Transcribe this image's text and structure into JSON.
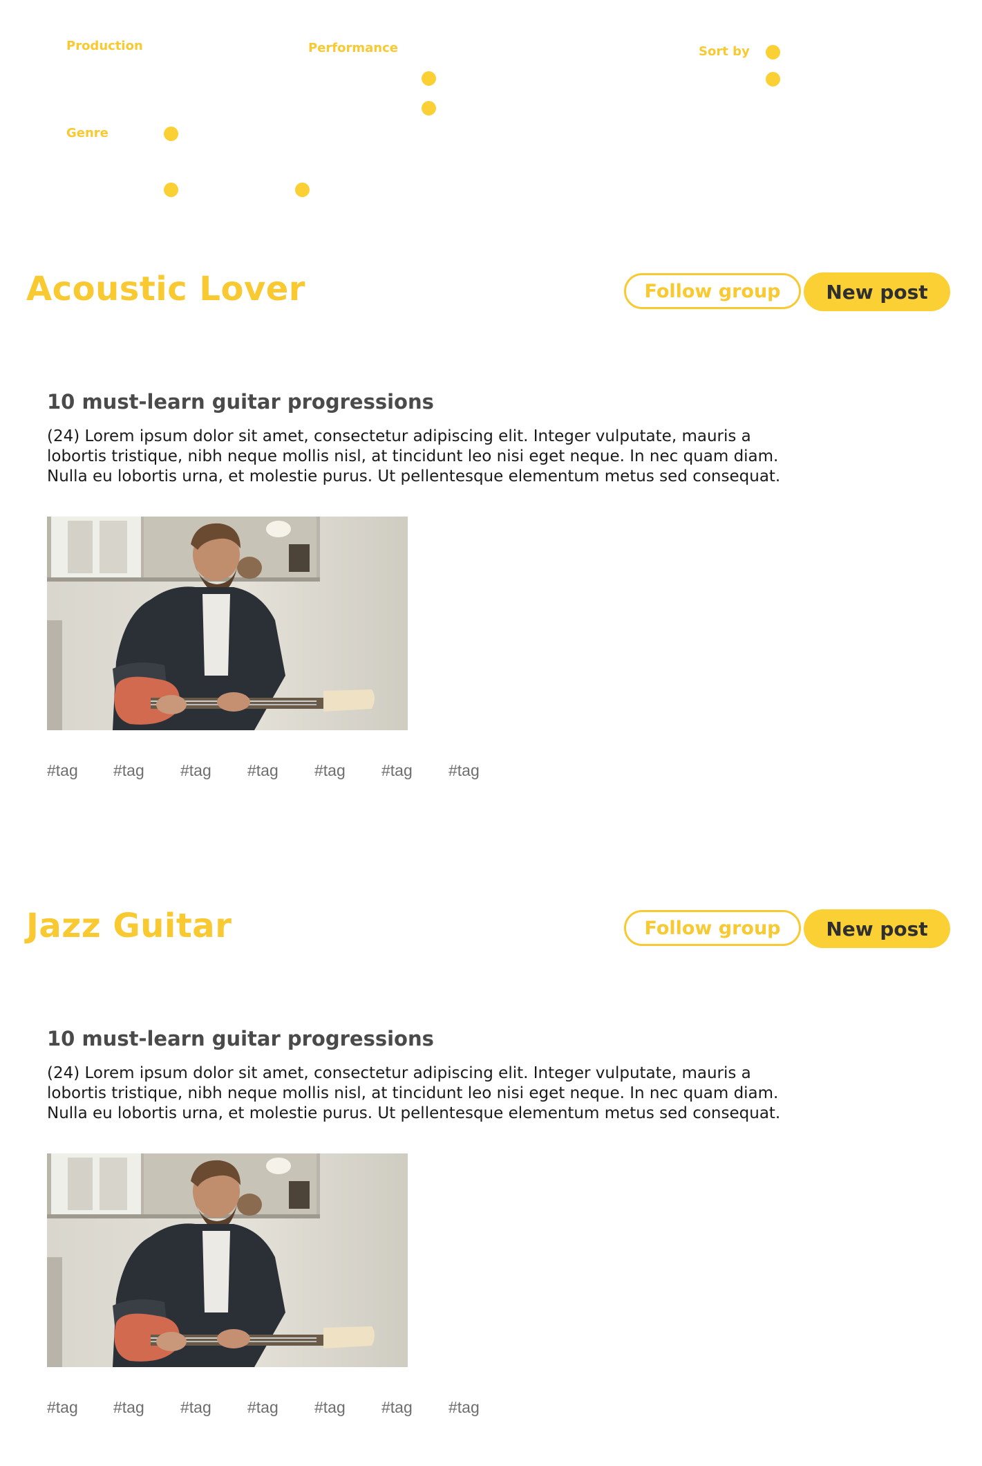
{
  "filters": {
    "production_label": "Production",
    "performance_label": "Performance",
    "sort_label": "Sort by",
    "genre_label": "Genre"
  },
  "groups": [
    {
      "title": "Acoustic Lover",
      "follow_label": "Follow group",
      "new_post_label": "New post",
      "post": {
        "title": "10 must-learn guitar progressions",
        "body_lines": [
          "(24) Lorem ipsum dolor sit amet, consectetur adipiscing elit. Integer vulputate, mauris a",
          "lobortis tristique, nibh neque mollis nisl, at tincidunt leo nisi eget neque. In nec quam diam.",
          "Nulla eu lobortis urna, et molestie purus. Ut pellentesque elementum metus sed consequat."
        ],
        "tags": [
          "#tag",
          "#tag",
          "#tag",
          "#tag",
          "#tag",
          "#tag",
          "#tag"
        ]
      }
    },
    {
      "title": "Jazz Guitar",
      "follow_label": "Follow group",
      "new_post_label": "New post",
      "post": {
        "title": "10 must-learn guitar progressions",
        "body_lines": [
          "(24) Lorem ipsum dolor sit amet, consectetur adipiscing elit. Integer vulputate, mauris a",
          "lobortis tristique, nibh neque mollis nisl, at tincidunt leo nisi eget neque. In nec quam diam.",
          "Nulla eu lobortis urna, et molestie purus. Ut pellentesque elementum metus sed consequat."
        ],
        "tags": [
          "#tag",
          "#tag",
          "#tag",
          "#tag",
          "#tag",
          "#tag",
          "#tag"
        ]
      }
    }
  ],
  "colors": {
    "accent": "#f9c931",
    "button_fill": "#fbd035",
    "title_text": "#4a4a4a",
    "tag_text": "#6e6e6e"
  }
}
